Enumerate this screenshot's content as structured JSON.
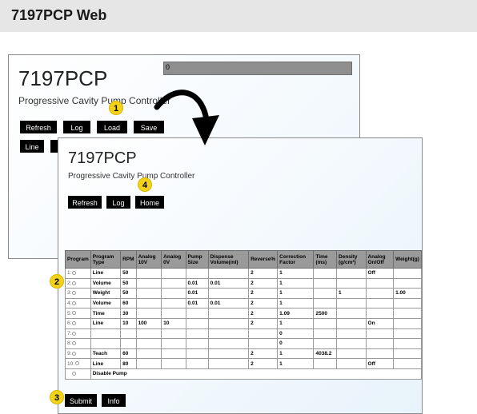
{
  "header": {
    "title": "7197PCP Web"
  },
  "back_window": {
    "title": "7197PCP",
    "subtitle": "Progressive Cavity Pump Controller",
    "progress_value": "0",
    "buttons": {
      "refresh": "Refresh",
      "log": "Log",
      "load": "Load",
      "save": "Save",
      "line": "Line"
    }
  },
  "front_window": {
    "title": "7197PCP",
    "subtitle": "Progressive Cavity Pump Controller",
    "buttons": {
      "refresh": "Refresh",
      "log": "Log",
      "home": "Home",
      "submit": "Submit",
      "info": "Info"
    }
  },
  "callouts": {
    "c1": "1",
    "c2": "2",
    "c3": "3",
    "c4": "4"
  },
  "table": {
    "headers": [
      "Program",
      "Program Type",
      "RPM",
      "Analog 10V",
      "Analog 0V",
      "Pump Size",
      "Dispense Volume(ml)",
      "Reverse%",
      "Correction Factor",
      "Time (ms)",
      "Density (g/cm³)",
      "Analog On/Off",
      "Weight(g)"
    ],
    "rows": [
      [
        "1:",
        "Line",
        "50",
        "",
        "",
        "",
        "",
        "2",
        "1",
        "",
        "",
        "Off",
        ""
      ],
      [
        "2:",
        "Volume",
        "50",
        "",
        "",
        "0.01",
        "0.01",
        "2",
        "1",
        "",
        "",
        "",
        ""
      ],
      [
        "3:",
        "Weight",
        "50",
        "",
        "",
        "0.01",
        "",
        "2",
        "1",
        "",
        "1",
        "",
        "1.00"
      ],
      [
        "4:",
        "Volume",
        "60",
        "",
        "",
        "0.01",
        "0.01",
        "2",
        "1",
        "",
        "",
        "",
        ""
      ],
      [
        "5:",
        "Time",
        "30",
        "",
        "",
        "",
        "",
        "2",
        "1.09",
        "2500",
        "",
        "",
        ""
      ],
      [
        "6:",
        "Line",
        "10",
        "100",
        "10",
        "",
        "",
        "2",
        "1",
        "",
        "",
        "On",
        ""
      ],
      [
        "7:",
        "",
        "",
        "",
        "",
        "",
        "",
        "",
        "0",
        "",
        "",
        "",
        ""
      ],
      [
        "8:",
        "",
        "",
        "",
        "",
        "",
        "",
        "",
        "0",
        "",
        "",
        "",
        ""
      ],
      [
        "9:",
        "Teach",
        "60",
        "",
        "",
        "",
        "",
        "2",
        "1",
        "4038.2",
        "",
        "",
        ""
      ],
      [
        "10:",
        "Line",
        "80",
        "",
        "",
        "",
        "",
        "2",
        "1",
        "",
        "",
        "Off",
        ""
      ]
    ],
    "disable_label": "Disable Pump"
  },
  "colors": {
    "accent_badge": "#f2d21b",
    "button_bg": "#000000",
    "header_band": "#e6e6e6",
    "table_header": "#9a9a9a"
  },
  "icons": {
    "arrow": "curved-arrow-icon",
    "radio": "radio-button-icon"
  }
}
